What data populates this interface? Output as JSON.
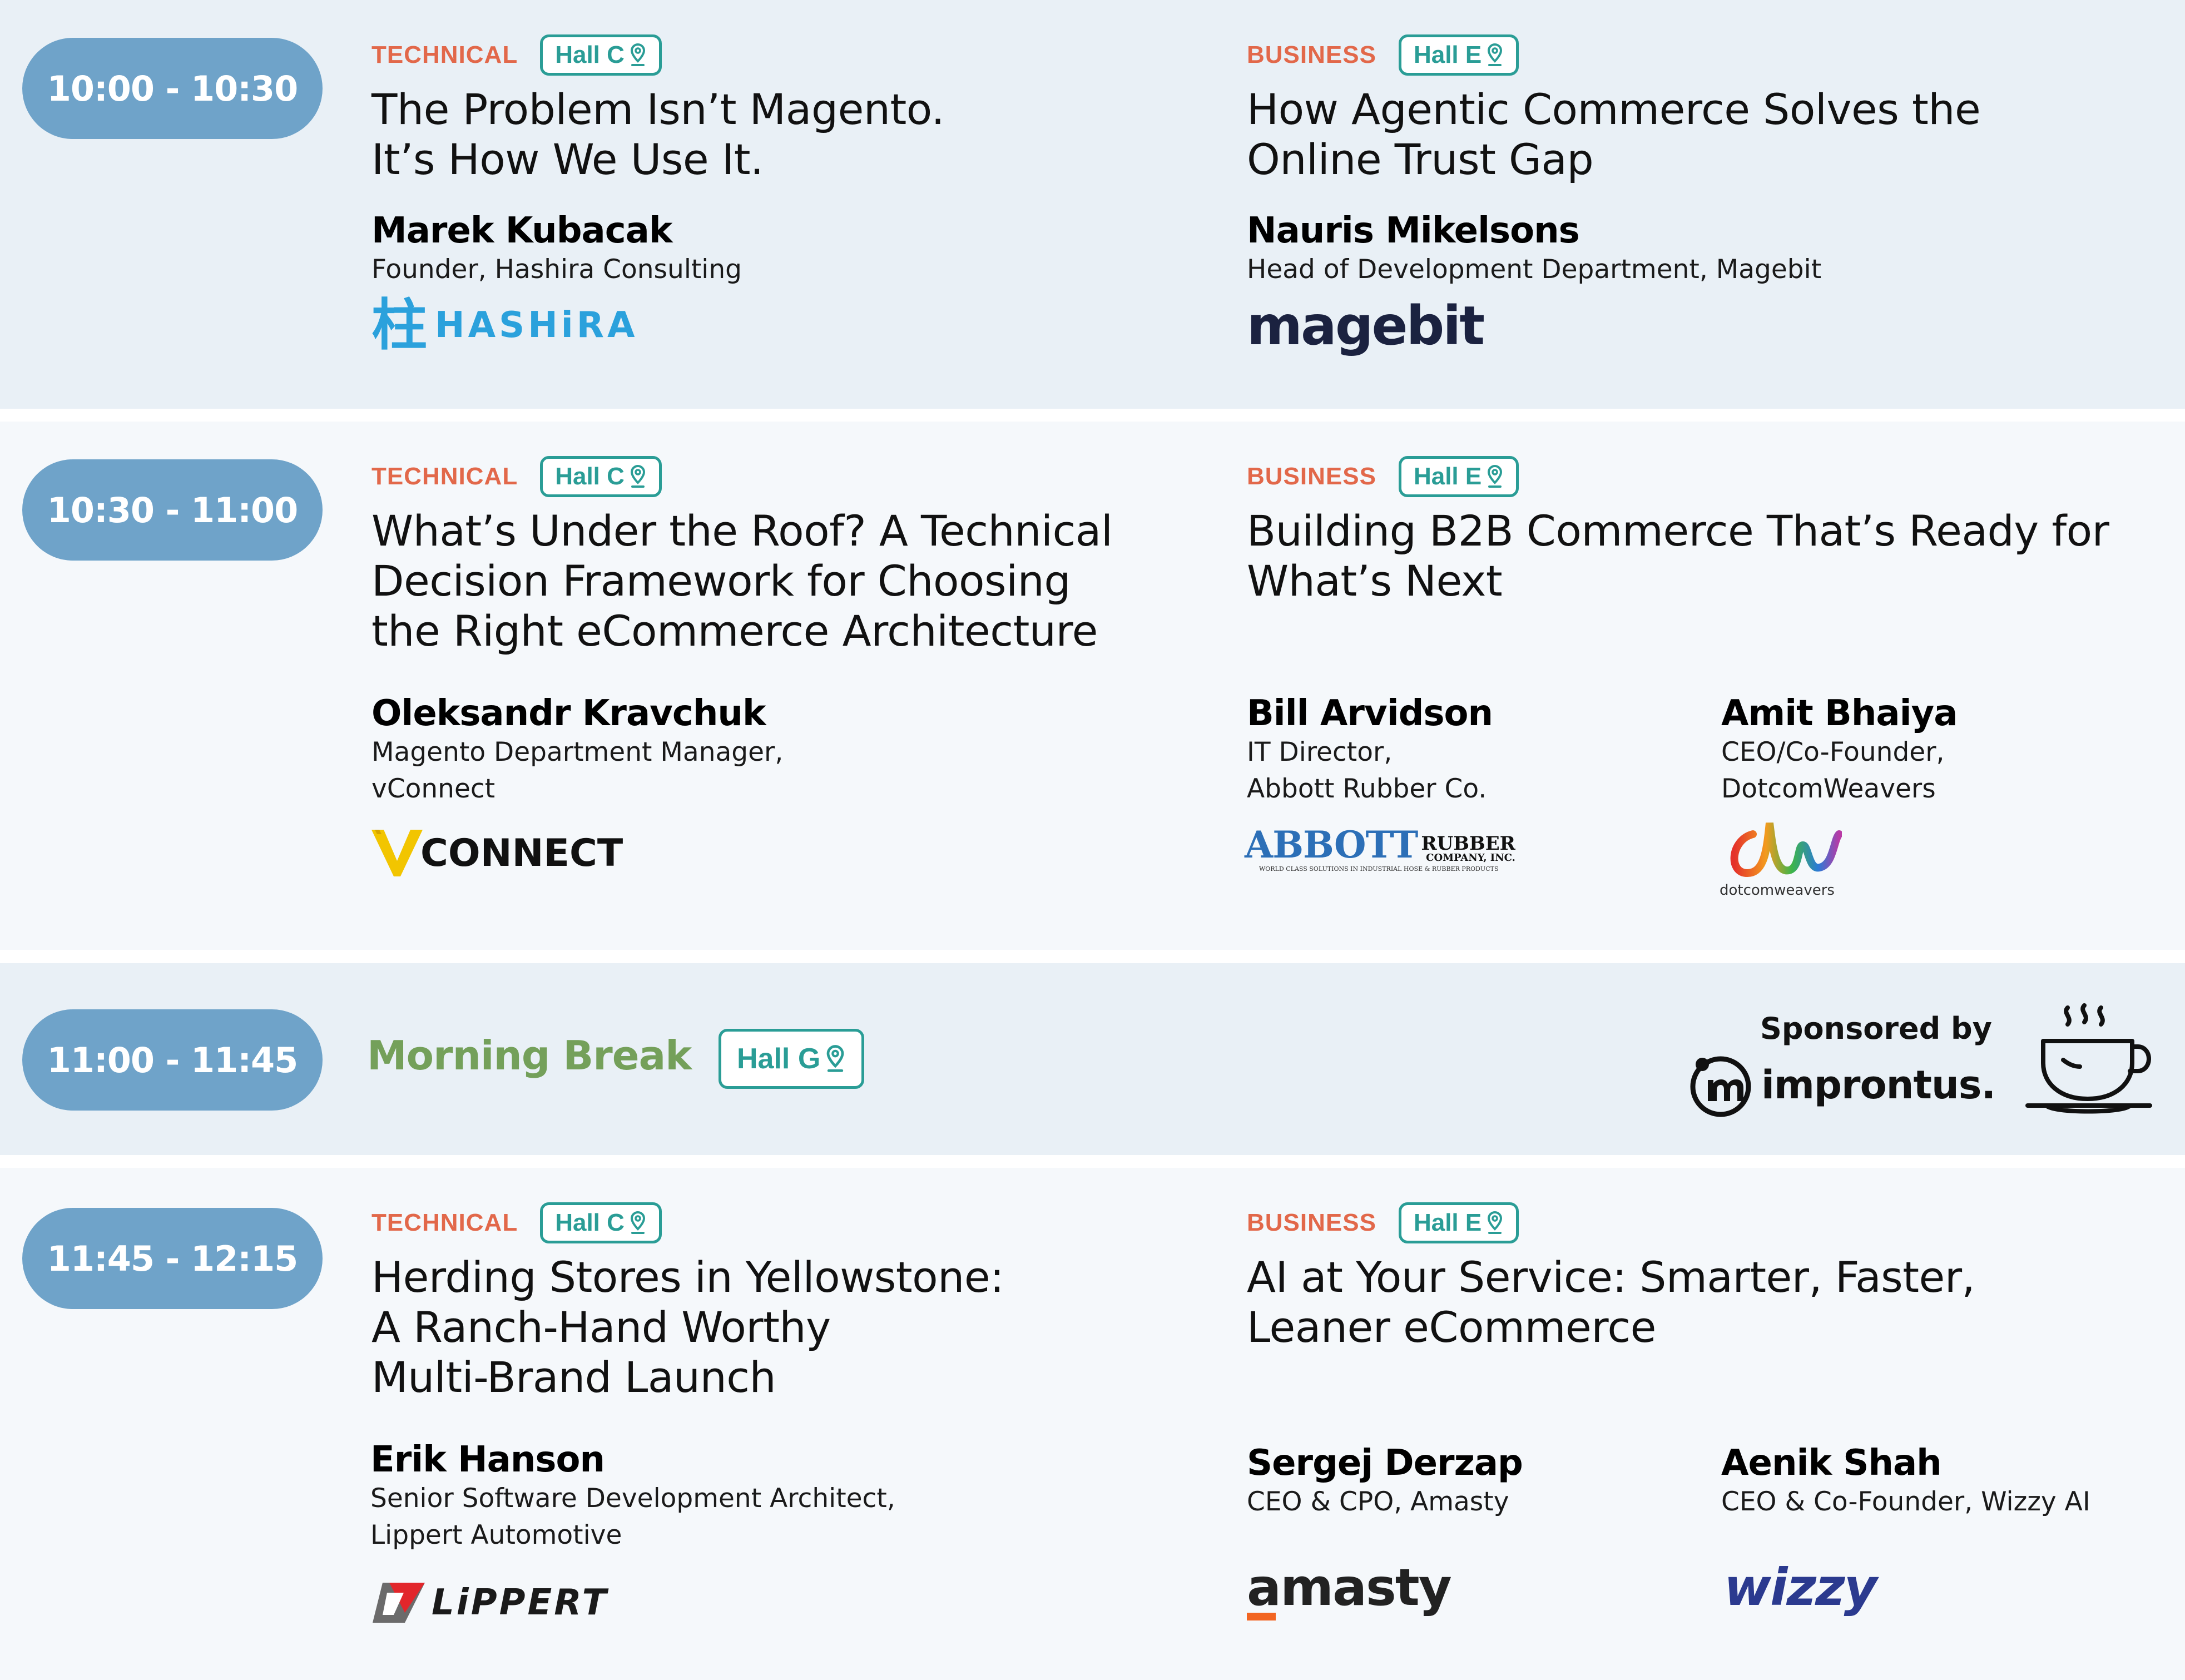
{
  "slots": [
    {
      "time": "10:00 - 10:30",
      "sessions": [
        {
          "track": "TECHNICAL",
          "hall": "Hall C",
          "title_lines": [
            "The Problem Isn’t Magento.",
            "It’s How We Use It."
          ],
          "speakers": [
            {
              "name": "Marek Kubacak",
              "role_lines": [
                "Founder, Hashira Consulting"
              ],
              "logo": "HASHiRA",
              "logo_mark": "柱"
            }
          ]
        },
        {
          "track": "BUSINESS",
          "hall": "Hall E",
          "title_lines": [
            "How Agentic Commerce Solves the",
            "Online Trust Gap"
          ],
          "speakers": [
            {
              "name": "Nauris Mikelsons",
              "role_lines": [
                "Head of Development Department, Magebit"
              ],
              "logo": "magebit"
            }
          ]
        }
      ]
    },
    {
      "time": "10:30 - 11:00",
      "sessions": [
        {
          "track": "TECHNICAL",
          "hall": "Hall C",
          "title_lines": [
            "What’s Under the Roof? A Technical",
            "Decision Framework for Choosing",
            "the Right eCommerce Architecture"
          ],
          "speakers": [
            {
              "name": "Oleksandr Kravchuk",
              "role_lines": [
                "Magento Department Manager,",
                "vConnect"
              ],
              "logo": "CONNECT"
            }
          ]
        },
        {
          "track": "BUSINESS",
          "hall": "Hall E",
          "title_lines": [
            "Building B2B Commerce That’s Ready for",
            "What’s Next"
          ],
          "speakers": [
            {
              "name": "Bill Arvidson",
              "role_lines": [
                "IT Director,",
                "Abbott Rubber Co."
              ],
              "logo": "ABBOTT",
              "logo_sub1": "RUBBER",
              "logo_sub2": "COMPANY, INC.",
              "logo_tag": "WORLD CLASS SOLUTIONS IN INDUSTRIAL HOSE & RUBBER PRODUCTS"
            },
            {
              "name": "Amit Bhaiya",
              "role_lines": [
                "CEO/Co-Founder,",
                "DotcomWeavers"
              ],
              "logo": "dotcomweavers"
            }
          ]
        }
      ]
    },
    {
      "time": "11:00 - 11:45",
      "break": {
        "title": "Morning Break",
        "hall": "Hall G",
        "sponsored_label": "Sponsored by",
        "sponsor": "improntus."
      }
    },
    {
      "time": "11:45 - 12:15",
      "sessions": [
        {
          "track": "TECHNICAL",
          "hall": "Hall C",
          "title_lines": [
            "Herding Stores in Yellowstone:",
            "A Ranch-Hand Worthy",
            "Multi-Brand Launch"
          ],
          "speakers": [
            {
              "name": "Erik Hanson",
              "role_lines": [
                "Senior Software Development Architect,",
                "Lippert Automotive"
              ],
              "logo": "LiPPERT"
            }
          ]
        },
        {
          "track": "BUSINESS",
          "hall": "Hall E",
          "title_lines": [
            "AI at Your Service: Smarter, Faster,",
            "Leaner eCommerce"
          ],
          "speakers": [
            {
              "name": "Sergej Derzap",
              "role_lines": [
                "CEO & CPO, Amasty"
              ],
              "logo": "amasty"
            },
            {
              "name": "Aenik Shah",
              "role_lines": [
                "CEO & Co-Founder, Wizzy AI"
              ],
              "logo": "wizzy"
            }
          ]
        }
      ]
    }
  ],
  "colors": {
    "time_pill": "#6fa3c9",
    "technical": "#e2684a",
    "business": "#e2684a",
    "hall_border": "#2a9d96",
    "break_title": "#74a05a",
    "row_alt": "#e9f0f6",
    "row_light": "#f5f8fb"
  }
}
